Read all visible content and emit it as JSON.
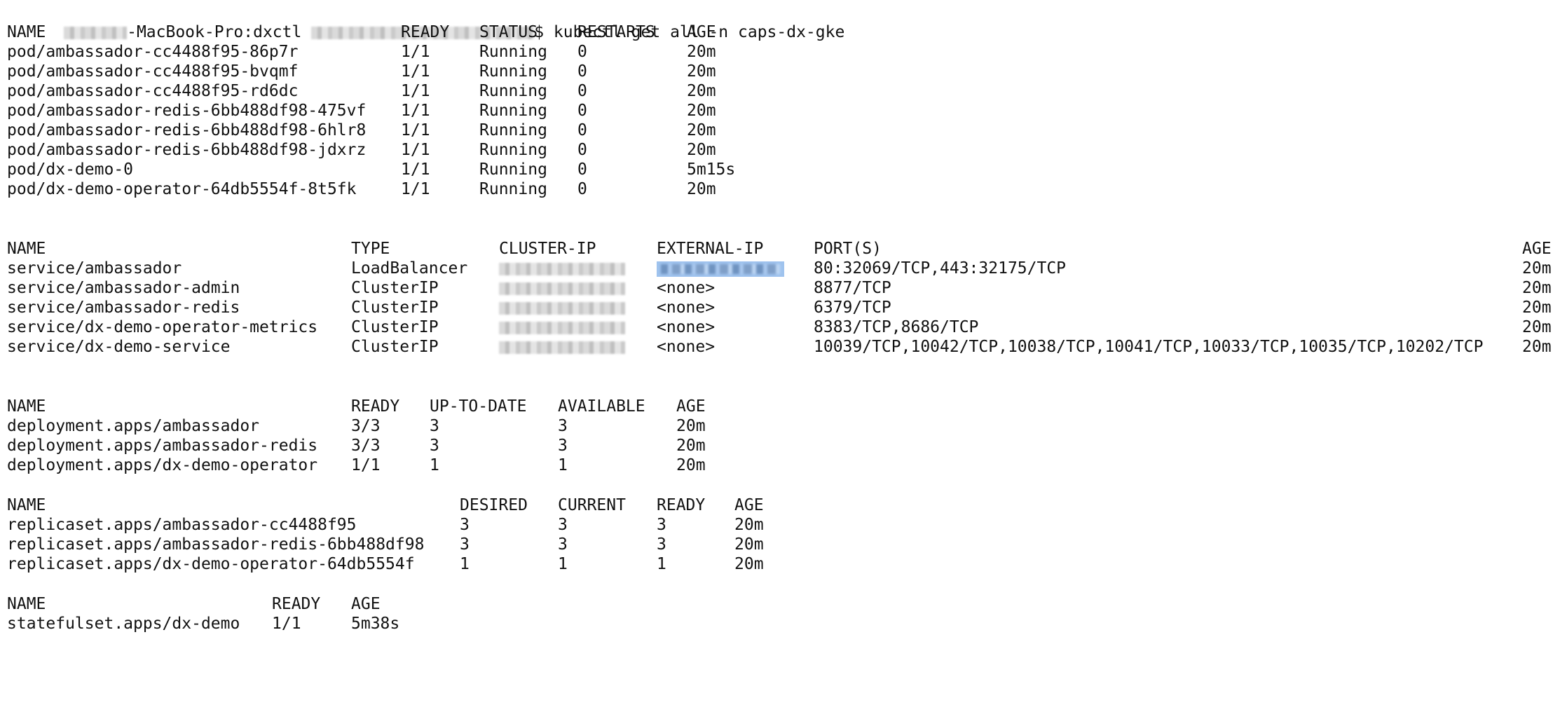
{
  "prompt": {
    "host_suffix": "-MacBook-Pro:dxctl",
    "command": "$ kubectl get all -n caps-dx-gke"
  },
  "pods": {
    "headers": [
      "NAME",
      "READY",
      "STATUS",
      "RESTARTS",
      "AGE"
    ],
    "rows": [
      [
        "pod/ambassador-cc4488f95-86p7r",
        "1/1",
        "Running",
        "0",
        "20m"
      ],
      [
        "pod/ambassador-cc4488f95-bvqmf",
        "1/1",
        "Running",
        "0",
        "20m"
      ],
      [
        "pod/ambassador-cc4488f95-rd6dc",
        "1/1",
        "Running",
        "0",
        "20m"
      ],
      [
        "pod/ambassador-redis-6bb488df98-475vf",
        "1/1",
        "Running",
        "0",
        "20m"
      ],
      [
        "pod/ambassador-redis-6bb488df98-6hlr8",
        "1/1",
        "Running",
        "0",
        "20m"
      ],
      [
        "pod/ambassador-redis-6bb488df98-jdxrz",
        "1/1",
        "Running",
        "0",
        "20m"
      ],
      [
        "pod/dx-demo-0",
        "1/1",
        "Running",
        "0",
        "5m15s"
      ],
      [
        "pod/dx-demo-operator-64db5554f-8t5fk",
        "1/1",
        "Running",
        "0",
        "20m"
      ]
    ]
  },
  "services": {
    "headers": [
      "NAME",
      "TYPE",
      "CLUSTER-IP",
      "EXTERNAL-IP",
      "PORT(S)",
      "AGE"
    ],
    "rows": [
      [
        "service/ambassador",
        "LoadBalancer",
        "",
        "",
        "80:32069/TCP,443:32175/TCP",
        "20m"
      ],
      [
        "service/ambassador-admin",
        "ClusterIP",
        "",
        "<none>",
        "8877/TCP",
        "20m"
      ],
      [
        "service/ambassador-redis",
        "ClusterIP",
        "",
        "<none>",
        "6379/TCP",
        "20m"
      ],
      [
        "service/dx-demo-operator-metrics",
        "ClusterIP",
        "",
        "<none>",
        "8383/TCP,8686/TCP",
        "20m"
      ],
      [
        "service/dx-demo-service",
        "ClusterIP",
        "",
        "<none>",
        "10039/TCP,10042/TCP,10038/TCP,10041/TCP,10033/TCP,10035/TCP,10202/TCP",
        "20m"
      ]
    ]
  },
  "deployments": {
    "headers": [
      "NAME",
      "READY",
      "UP-TO-DATE",
      "AVAILABLE",
      "AGE"
    ],
    "rows": [
      [
        "deployment.apps/ambassador",
        "3/3",
        "3",
        "3",
        "20m"
      ],
      [
        "deployment.apps/ambassador-redis",
        "3/3",
        "3",
        "3",
        "20m"
      ],
      [
        "deployment.apps/dx-demo-operator",
        "1/1",
        "1",
        "1",
        "20m"
      ]
    ]
  },
  "replicasets": {
    "headers": [
      "NAME",
      "DESIRED",
      "CURRENT",
      "READY",
      "AGE"
    ],
    "rows": [
      [
        "replicaset.apps/ambassador-cc4488f95",
        "3",
        "3",
        "3",
        "20m"
      ],
      [
        "replicaset.apps/ambassador-redis-6bb488df98",
        "3",
        "3",
        "3",
        "20m"
      ],
      [
        "replicaset.apps/dx-demo-operator-64db5554f",
        "1",
        "1",
        "1",
        "20m"
      ]
    ]
  },
  "statefulsets": {
    "headers": [
      "NAME",
      "READY",
      "AGE"
    ],
    "rows": [
      [
        "statefulset.apps/dx-demo",
        "1/1",
        "5m38s"
      ]
    ]
  },
  "colors": {
    "text": "#111111",
    "background": "#ffffff",
    "selection_highlight": "#9fc3ee"
  }
}
